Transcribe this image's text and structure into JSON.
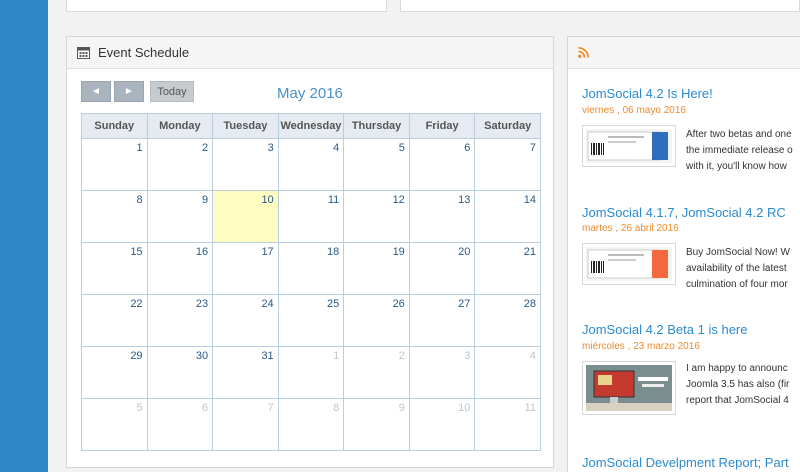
{
  "calendar_panel": {
    "title": "Event Schedule",
    "prev_label": "◄",
    "next_label": "►",
    "today_label": "Today",
    "month_title": "May 2016",
    "weekdays": [
      "Sunday",
      "Monday",
      "Tuesday",
      "Wednesday",
      "Thursday",
      "Friday",
      "Saturday"
    ],
    "weeks": [
      [
        "1",
        "2",
        "3",
        "4",
        "5",
        "6",
        "7"
      ],
      [
        "8",
        "9",
        "10",
        "11",
        "12",
        "13",
        "14"
      ],
      [
        "15",
        "16",
        "17",
        "18",
        "19",
        "20",
        "21"
      ],
      [
        "22",
        "23",
        "24",
        "25",
        "26",
        "27",
        "28"
      ],
      [
        "29",
        "30",
        "31",
        "1",
        "2",
        "3",
        "4"
      ],
      [
        "5",
        "6",
        "7",
        "8",
        "9",
        "10",
        "11"
      ]
    ],
    "today_day": "10"
  },
  "feed_panel": {
    "items": [
      {
        "title": "JomSocial 4.2 Is Here!",
        "date": "viernes , 06 mayo 2016",
        "lines": [
          "After two betas and one",
          "the immediate release o",
          "with it, you'll know how"
        ]
      },
      {
        "title": "JomSocial 4.1.7, JomSocial 4.2 RC",
        "date": "martes , 26 abril 2016",
        "lines": [
          "Buy JomSocial Now! W",
          "availability of the latest",
          "culmination of four mor"
        ]
      },
      {
        "title": "JomSocial 4.2 Beta 1 is here",
        "date": "miércoles , 23 marzo 2016",
        "lines": [
          "I am happy to announc",
          "Joomla 3.5 has also (fir",
          "report that JomSocial 4"
        ]
      },
      {
        "title": "JomSocial Develpment Report; Part"
      }
    ]
  },
  "colors": {
    "sidebar": "#2f86c4",
    "link": "#2a8bd0",
    "date": "#ee8a2c",
    "today": "#fffcc2"
  }
}
